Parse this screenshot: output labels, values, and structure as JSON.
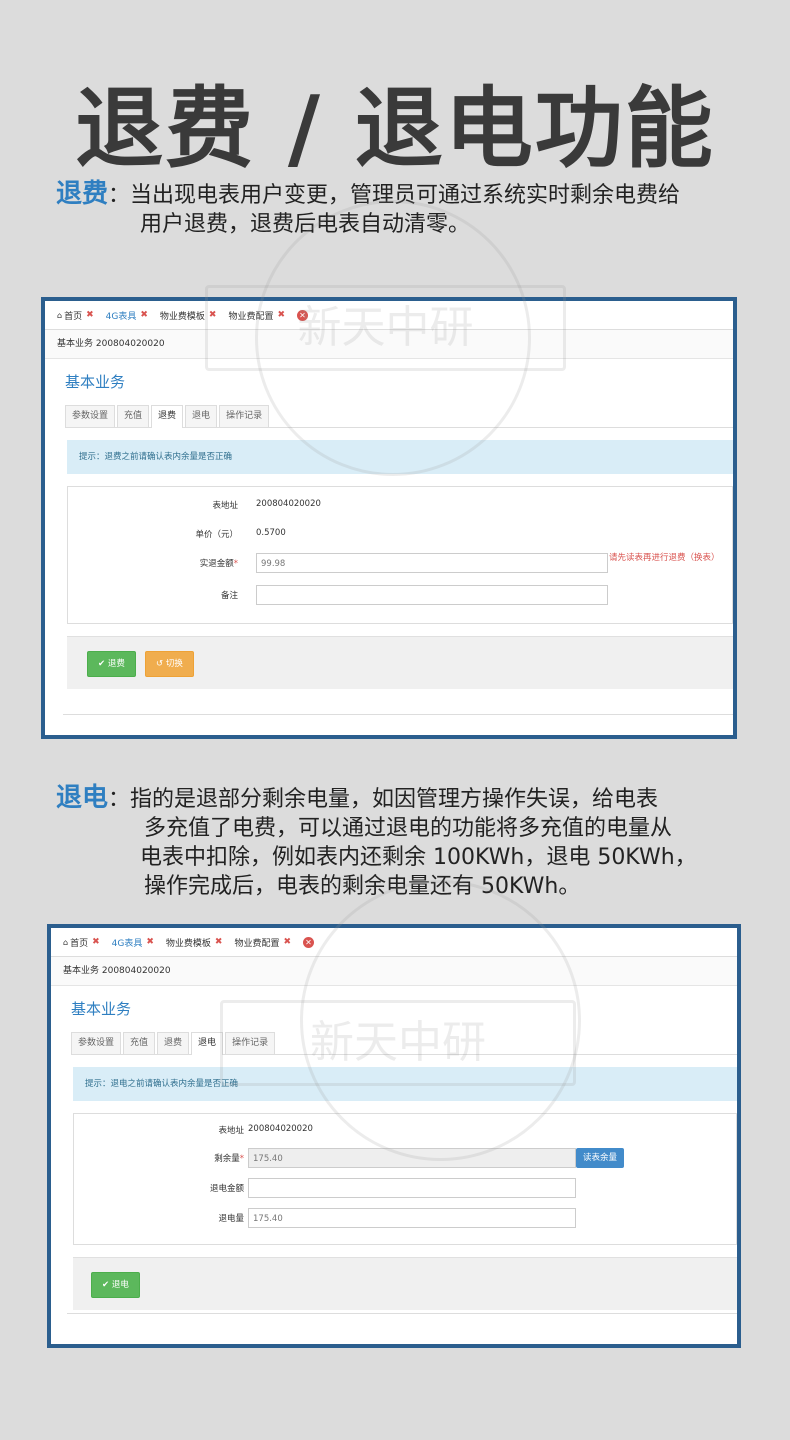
{
  "hero": {
    "title": "退费 / 退电功能"
  },
  "refund_desc": {
    "label": "退费",
    "colon": "：",
    "line1": "当出现电表用户变更，管理员可通过系统实时剩余电费给",
    "line2": "用户退费，退费后电表自动清零。"
  },
  "power_desc": {
    "label": "退电",
    "colon": "：",
    "line1": "指的是退部分剩余电量，如因管理方操作失误，给电表",
    "line2": "多充值了电费，可以通过退电的功能将多充值的电量从",
    "line3": "电表中扣除，例如表内还剩余 100KWh，退电 50KWh，",
    "line4": "操作完成后，电表的剩余电量还有 50KWh。"
  },
  "watermark": {
    "text": "新天中研"
  },
  "panel1": {
    "tabs": [
      {
        "label": "首页",
        "icon": "home-icon"
      },
      {
        "label": "4G表具"
      },
      {
        "label": "物业费模板"
      },
      {
        "label": "物业费配置"
      }
    ],
    "breadcrumb": "基本业务 200804020020",
    "page_title": "基本业务",
    "subtabs": [
      "参数设置",
      "充值",
      "退费",
      "退电",
      "操作记录"
    ],
    "active_subtab": "退费",
    "alert": "提示：退费之前请确认表内余量是否正确",
    "fields": {
      "address_label": "表地址",
      "address_value": "200804020020",
      "price_label": "单价（元）",
      "price_value": "0.5700",
      "refund_label": "实退金额",
      "refund_value": "99.98",
      "refund_error": "请先读表再进行退费（换表）",
      "remark_label": "备注",
      "remark_value": ""
    },
    "buttons": {
      "refund": "退费",
      "switch": "切换"
    }
  },
  "panel2": {
    "tabs": [
      {
        "label": "首页",
        "icon": "home-icon"
      },
      {
        "label": "4G表具"
      },
      {
        "label": "物业费模板"
      },
      {
        "label": "物业费配置"
      }
    ],
    "breadcrumb": "基本业务 200804020020",
    "page_title": "基本业务",
    "subtabs": [
      "参数设置",
      "充值",
      "退费",
      "退电",
      "操作记录"
    ],
    "active_subtab": "退电",
    "alert": "提示：退电之前请确认表内余量是否正确",
    "fields": {
      "address_label": "表地址",
      "address_value": "200804020020",
      "remaining_label": "剩余量",
      "remaining_value": "175.40",
      "read_button": "读表余量",
      "amount_label": "退电金额",
      "amount_value": "",
      "quantity_label": "退电量",
      "quantity_value": "175.40"
    },
    "buttons": {
      "refund_power": "退电"
    }
  },
  "colors": {
    "accent": "#2f7fc1",
    "border": "#2b5e8e",
    "success": "#5cb85c",
    "warning": "#f0ad4e",
    "danger": "#d9534f"
  }
}
